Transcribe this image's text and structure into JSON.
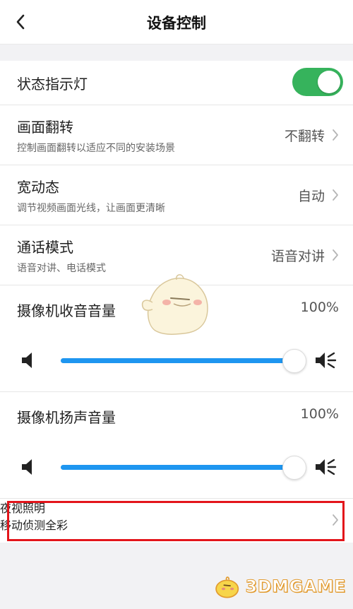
{
  "header": {
    "title": "设备控制"
  },
  "rows": {
    "status_light": {
      "label": "状态指示灯",
      "enabled": true
    },
    "flip": {
      "label": "画面翻转",
      "desc": "控制画面翻转以适应不同的安装场景",
      "value": "不翻转"
    },
    "wdr": {
      "label": "宽动态",
      "desc": "调节视频画面光线，让画面更清晰",
      "value": "自动"
    },
    "call_mode": {
      "label": "通话模式",
      "desc": "语音对讲、电话模式",
      "value": "语音对讲"
    },
    "mic_volume": {
      "label": "摄像机收音音量",
      "value_text": "100%",
      "level": 1.0
    },
    "speaker_volume": {
      "label": "摄像机扬声音量",
      "value_text": "100%",
      "level": 1.0
    },
    "night_vision": {
      "label": "夜视照明",
      "value": "移动侦测全彩"
    }
  },
  "watermark": {
    "text": "3DMGAME"
  },
  "colors": {
    "toggle_on": "#36b35c",
    "slider_fill": "#1e96f0",
    "highlight": "#e3151b"
  },
  "icons": {
    "back": "chevron-left-icon",
    "chevron": "chevron-right-icon",
    "volume_low": "speaker-low-icon",
    "volume_high": "speaker-high-icon"
  }
}
